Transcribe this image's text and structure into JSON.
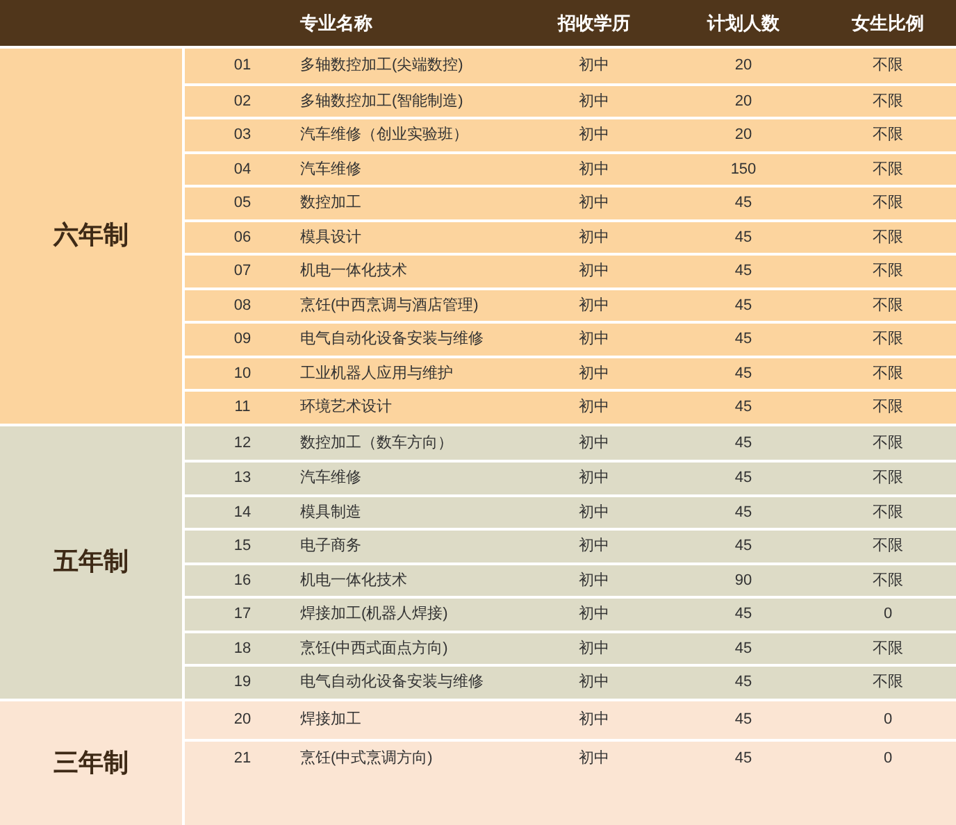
{
  "table": {
    "columns": [
      "专业名称",
      "招收学历",
      "计划人数",
      "女生比例"
    ],
    "groups": [
      {
        "label": "六年制",
        "color": "#fcd49e",
        "rows": [
          {
            "no": "01",
            "name": "多轴数控加工(尖端数控)",
            "edu": "初中",
            "count": "20",
            "ratio": "不限"
          },
          {
            "no": "02",
            "name": "多轴数控加工(智能制造)",
            "edu": "初中",
            "count": "20",
            "ratio": "不限"
          },
          {
            "no": "03",
            "name": "汽车维修（创业实验班）",
            "edu": "初中",
            "count": "20",
            "ratio": "不限"
          },
          {
            "no": "04",
            "name": "汽车维修",
            "edu": "初中",
            "count": "150",
            "ratio": "不限"
          },
          {
            "no": "05",
            "name": "数控加工",
            "edu": "初中",
            "count": "45",
            "ratio": "不限"
          },
          {
            "no": "06",
            "name": "模具设计",
            "edu": "初中",
            "count": "45",
            "ratio": "不限"
          },
          {
            "no": "07",
            "name": "机电一体化技术",
            "edu": "初中",
            "count": "45",
            "ratio": "不限"
          },
          {
            "no": "08",
            "name": "烹饪(中西烹调与酒店管理)",
            "edu": "初中",
            "count": "45",
            "ratio": "不限"
          },
          {
            "no": "09",
            "name": "电气自动化设备安装与维修",
            "edu": "初中",
            "count": "45",
            "ratio": "不限"
          },
          {
            "no": "10",
            "name": "工业机器人应用与维护",
            "edu": "初中",
            "count": "45",
            "ratio": "不限"
          },
          {
            "no": "11",
            "name": "环境艺术设计",
            "edu": "初中",
            "count": "45",
            "ratio": "不限"
          }
        ]
      },
      {
        "label": "五年制",
        "color": "#dddbc6",
        "rows": [
          {
            "no": "12",
            "name": "数控加工（数车方向）",
            "edu": "初中",
            "count": "45",
            "ratio": "不限"
          },
          {
            "no": "13",
            "name": "汽车维修",
            "edu": "初中",
            "count": "45",
            "ratio": "不限"
          },
          {
            "no": "14",
            "name": "模具制造",
            "edu": "初中",
            "count": "45",
            "ratio": "不限"
          },
          {
            "no": "15",
            "name": "电子商务",
            "edu": "初中",
            "count": "45",
            "ratio": "不限"
          },
          {
            "no": "16",
            "name": "机电一体化技术",
            "edu": "初中",
            "count": "90",
            "ratio": "不限"
          },
          {
            "no": "17",
            "name": "焊接加工(机器人焊接)",
            "edu": "初中",
            "count": "45",
            "ratio": "0"
          },
          {
            "no": "18",
            "name": "烹饪(中西式面点方向)",
            "edu": "初中",
            "count": "45",
            "ratio": "不限"
          },
          {
            "no": "19",
            "name": "电气自动化设备安装与维修",
            "edu": "初中",
            "count": "45",
            "ratio": "不限"
          }
        ]
      },
      {
        "label": "三年制",
        "color": "#fbe5d3",
        "rows": [
          {
            "no": "20",
            "name": "焊接加工",
            "edu": "初中",
            "count": "45",
            "ratio": "0"
          },
          {
            "no": "21",
            "name": "烹饪(中式烹调方向)",
            "edu": "初中",
            "count": "45",
            "ratio": "0"
          }
        ]
      }
    ]
  }
}
